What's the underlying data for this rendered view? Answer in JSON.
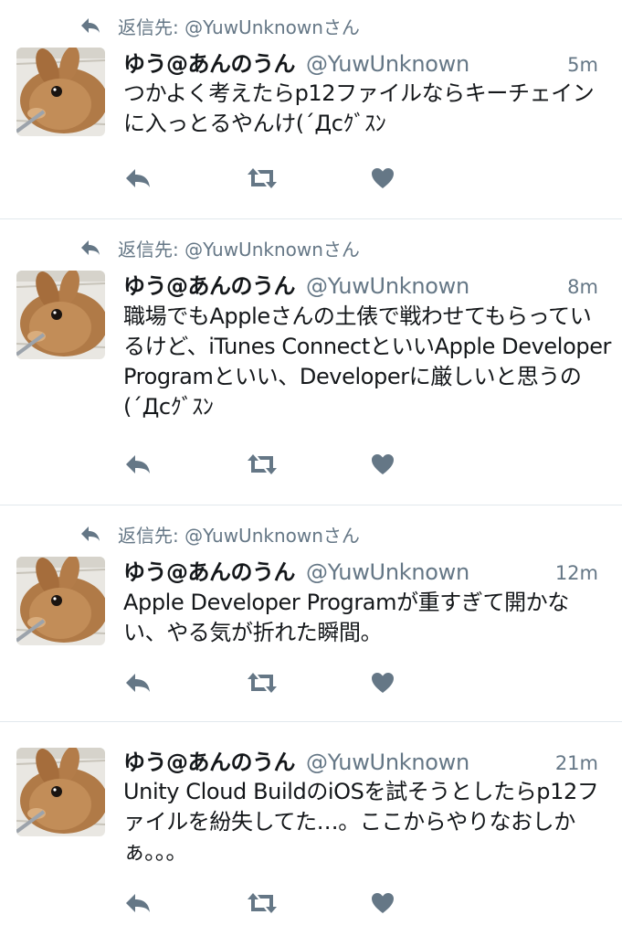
{
  "colors": {
    "text": "#14171a",
    "secondary": "#657786",
    "divider": "#e1e8ed",
    "icon": "#657786"
  },
  "icons": {
    "reply": "reply-arrow-icon",
    "retweet": "retweet-icon",
    "like": "heart-icon"
  },
  "tweets": [
    {
      "context": "返信先: @YuwUnknownさん",
      "name": "ゆう@あんのうん",
      "handle": "@YuwUnknown",
      "time": "5m",
      "text": "つかよく考えたらp12ファイルならキーチェインに入っとるやんけ(´Дcｸﾞｽﾝ"
    },
    {
      "context": "返信先: @YuwUnknownさん",
      "name": "ゆう@あんのうん",
      "handle": "@YuwUnknown",
      "time": "8m",
      "text": "職場でもAppleさんの土俵で戦わせてもらっているけど、iTunes ConnectといいApple Developer Programといい、Developerに厳しいと思うの(´Дcｸﾞｽﾝ"
    },
    {
      "context": "返信先: @YuwUnknownさん",
      "name": "ゆう@あんのうん",
      "handle": "@YuwUnknown",
      "time": "12m",
      "text": "Apple Developer Programが重すぎて開かない、やる気が折れた瞬間。"
    },
    {
      "name": "ゆう@あんのうん",
      "handle": "@YuwUnknown",
      "time": "21m",
      "text": "Unity Cloud BuildのiOSを試そうとしたらp12ファイルを紛失してた…。ここからやりなおしかぁ。。。"
    }
  ]
}
